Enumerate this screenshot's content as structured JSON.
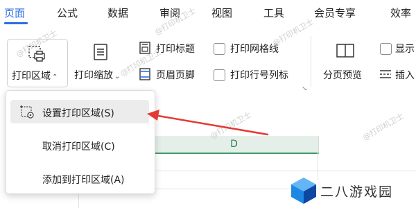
{
  "menu": {
    "tabs": [
      {
        "label": "页面",
        "active": true
      },
      {
        "label": "公式"
      },
      {
        "label": "数据"
      },
      {
        "label": "审阅"
      },
      {
        "label": "视图"
      },
      {
        "label": "工具"
      },
      {
        "label": "会员专享"
      },
      {
        "label": "效率"
      }
    ],
    "active_color": "#2f6ee0"
  },
  "ribbon": {
    "print_area_label": "打印区域",
    "print_scale_label": "打印缩放",
    "print_titles_label": "打印标题",
    "header_footer_label": "页眉页脚",
    "print_gridlines_label": "打印网格线",
    "print_row_col_label": "打印行号列标",
    "page_break_preview_label": "分页预览",
    "show_label": "显示",
    "insert_label": "插入"
  },
  "dropdown": {
    "items": [
      {
        "label": "设置打印区域(S)",
        "hovered": true
      },
      {
        "label": "取消打印区域(C)"
      },
      {
        "label": "添加到打印区域(A)"
      }
    ]
  },
  "sheet": {
    "column_header": "D",
    "column_header_color": "#3f9b6a"
  },
  "watermark": "@打印机卫士",
  "logo": {
    "text": "二八游戏园",
    "colors": [
      "#1e88e5",
      "#64b5f6",
      "#0d47a1"
    ]
  },
  "annotation": {
    "arrow_color": "#e53935"
  }
}
